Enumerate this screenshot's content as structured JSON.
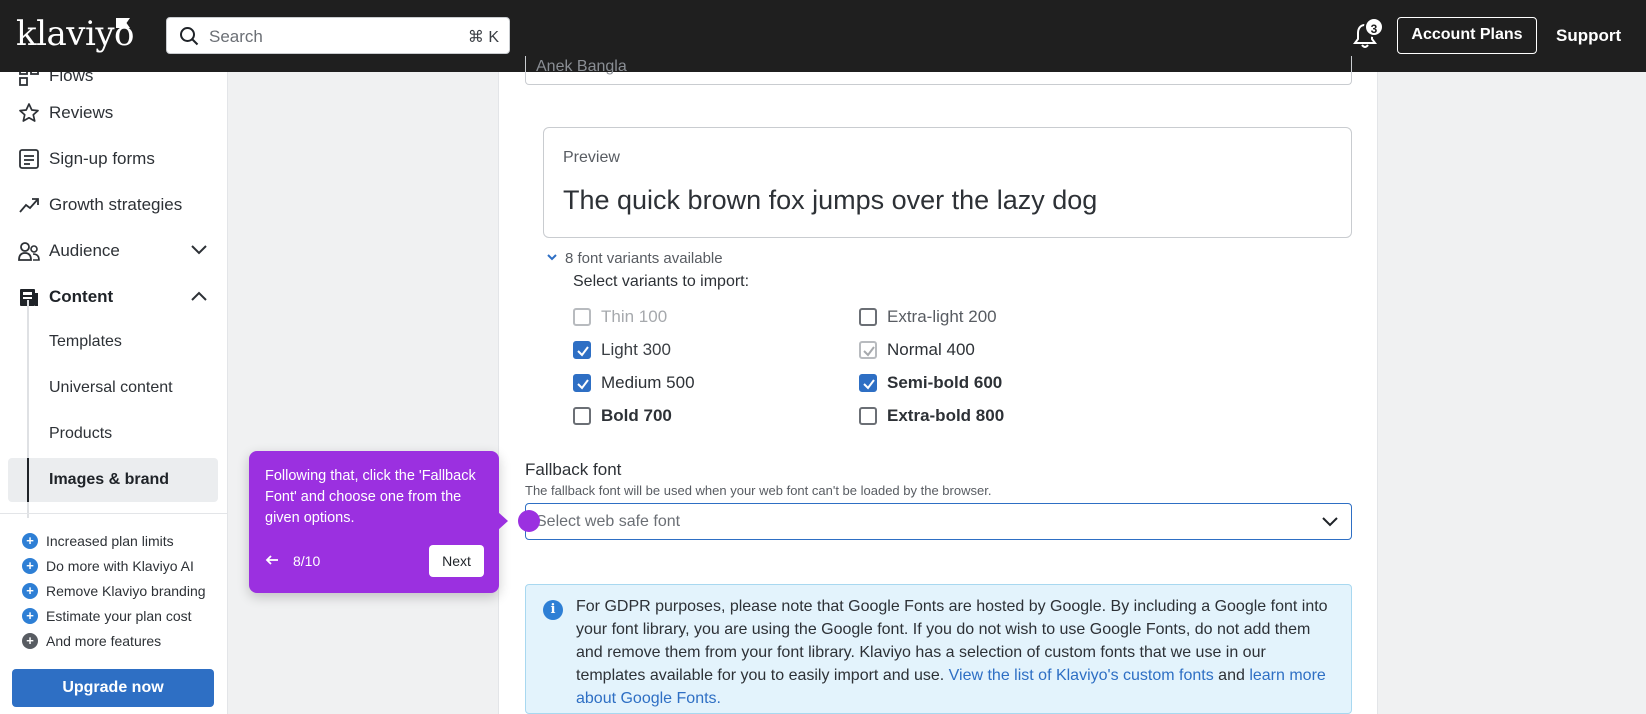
{
  "topbar": {
    "logo": "klaviyo",
    "search_placeholder": "Search",
    "search_shortcut": "⌘ K",
    "notification_count": "3",
    "account_plans": "Account Plans",
    "support": "Support"
  },
  "sidebar": {
    "items": [
      {
        "label": "Flows",
        "icon": "flows-icon"
      },
      {
        "label": "Reviews",
        "icon": "star-icon"
      },
      {
        "label": "Sign-up forms",
        "icon": "form-icon"
      },
      {
        "label": "Growth strategies",
        "icon": "trend-icon"
      },
      {
        "label": "Audience",
        "icon": "people-icon"
      },
      {
        "label": "Content",
        "icon": "content-icon"
      }
    ],
    "sub_items": [
      "Templates",
      "Universal content",
      "Products",
      "Images & brand"
    ],
    "features": [
      "Increased plan limits",
      "Do more with Klaviyo AI",
      "Remove Klaviyo branding",
      "Estimate your plan cost",
      "And more features"
    ],
    "upgrade": "Upgrade now"
  },
  "main": {
    "top_input_value": "Anek Bangla",
    "preview_label": "Preview",
    "preview_text": "The quick brown fox jumps over the lazy dog",
    "variants_toggle": "8 font variants available",
    "select_variants": "Select variants to import:",
    "variants": [
      {
        "label": "Thin 100",
        "state": "disabled"
      },
      {
        "label": "Extra-light 200",
        "state": "unchecked"
      },
      {
        "label": "Light 300",
        "state": "checked"
      },
      {
        "label": "Normal 400",
        "state": "checked-disabled"
      },
      {
        "label": "Medium 500",
        "state": "checked"
      },
      {
        "label": "Semi-bold 600",
        "state": "checked"
      },
      {
        "label": "Bold 700",
        "state": "unchecked"
      },
      {
        "label": "Extra-bold 800",
        "state": "unchecked"
      }
    ],
    "fallback_label": "Fallback font",
    "fallback_help": "The fallback font will be used when your web font can't be loaded by the browser.",
    "fallback_placeholder": "Select web safe font",
    "gdpr_text": "For GDPR purposes, please note that Google Fonts are hosted by Google. By including a Google font into your font library, you are using the Google font. If you do not wish to use Google Fonts, do not add them and remove them from your font library. Klaviyo has a selection of custom fonts that we use in our templates available for you to easily import and use. ",
    "gdpr_link1": "View the list of Klaviyo's custom fonts",
    "gdpr_and": " and ",
    "gdpr_link2": "learn more about Google Fonts."
  },
  "tooltip": {
    "text": "Following that, click the 'Fallback Font' and choose one from the given options.",
    "step": "8/10",
    "next": "Next"
  },
  "colors": {
    "accent": "#2e6fc4",
    "tooltip": "#9b30e0",
    "topbar": "#1f1f1f"
  }
}
